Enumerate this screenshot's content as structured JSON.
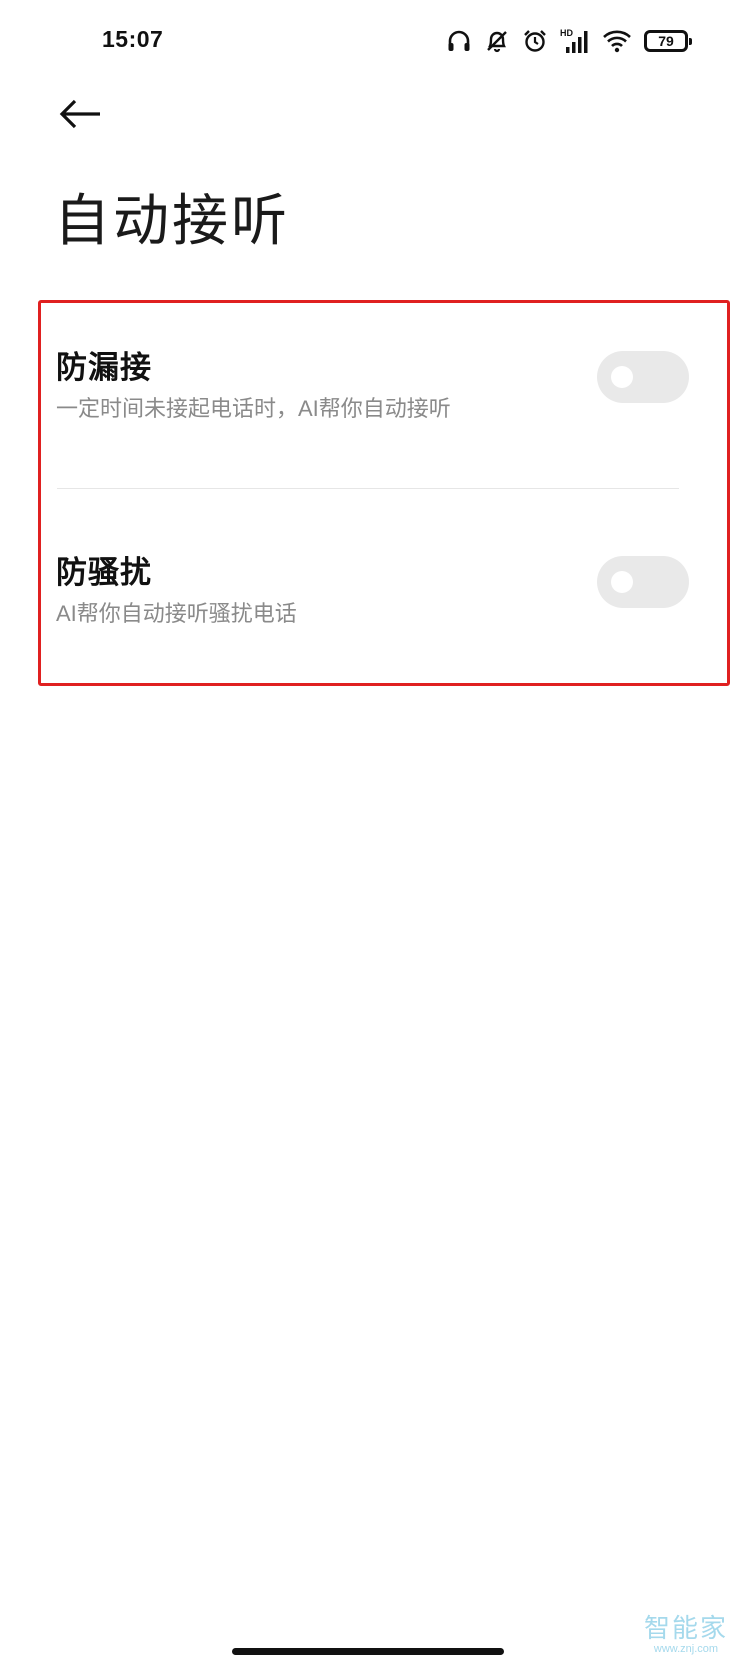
{
  "status_bar": {
    "time": "15:07",
    "icons": [
      "headphones-icon",
      "bell-off-icon",
      "alarm-icon",
      "hd-signal-icon",
      "wifi-icon",
      "battery-icon"
    ],
    "signal_label": "HD",
    "battery_level": "79"
  },
  "header": {
    "back_icon": "arrow-left-icon",
    "title": "自动接听"
  },
  "settings": {
    "items": [
      {
        "title": "防漏接",
        "description": "一定时间未接起电话时，AI帮你自动接听",
        "enabled": false
      },
      {
        "title": "防骚扰",
        "description": "AI帮你自动接听骚扰电话",
        "enabled": false
      }
    ],
    "highlight_color": "#e02020"
  },
  "watermark": {
    "text": "智能家",
    "url": "www.znj.com"
  }
}
